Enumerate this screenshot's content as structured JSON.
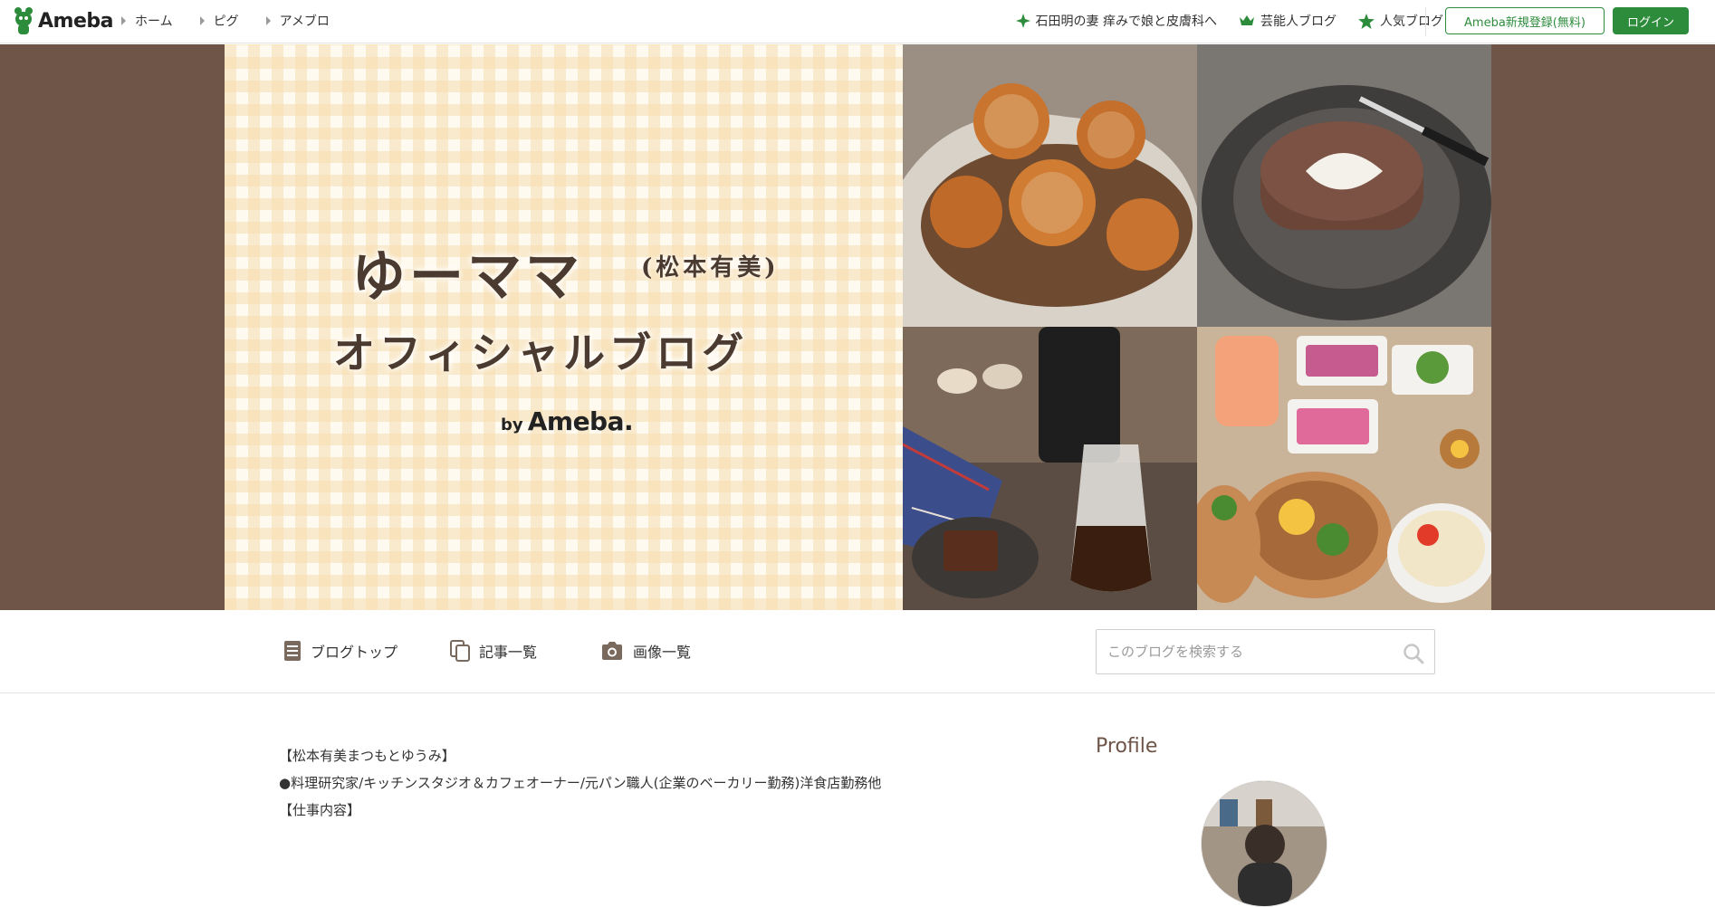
{
  "topbar": {
    "logo_text": "Ameba",
    "nav": [
      {
        "label": "ホーム"
      },
      {
        "label": "ピグ"
      },
      {
        "label": "アメブロ"
      }
    ],
    "right_links": [
      {
        "label": "石田明の妻 痒みで娘と皮膚科へ",
        "icon": "sparkle-icon"
      },
      {
        "label": "芸能人ブログ",
        "icon": "crown-icon"
      },
      {
        "label": "人気ブログ",
        "icon": "star-icon"
      }
    ],
    "register_button": "Ameba新規登録(無料)",
    "login_button": "ログイン"
  },
  "banner": {
    "title_main": "ゆーママ",
    "title_sub": "(松本有美)",
    "title_line2": "オフィシャルブログ",
    "by": "by",
    "brand": "Ameba."
  },
  "blog_nav": {
    "items": [
      {
        "label": "ブログトップ",
        "icon": "document-icon"
      },
      {
        "label": "記事一覧",
        "icon": "copy-icon"
      },
      {
        "label": "画像一覧",
        "icon": "camera-icon"
      }
    ],
    "search_placeholder": "このブログを検索する"
  },
  "content": {
    "lines": [
      "【松本有美まつもとゆうみ】",
      "●料理研究家/キッチンスタジオ＆カフェオーナー/元パン職人(企業のベーカリー勤務)洋食店勤務他",
      "【仕事内容】"
    ]
  },
  "sidebar": {
    "profile_title": "Profile"
  },
  "colors": {
    "brand_green": "#2d8c3c",
    "banner_bg": "#6e5548",
    "profile_title": "#6e5548"
  }
}
